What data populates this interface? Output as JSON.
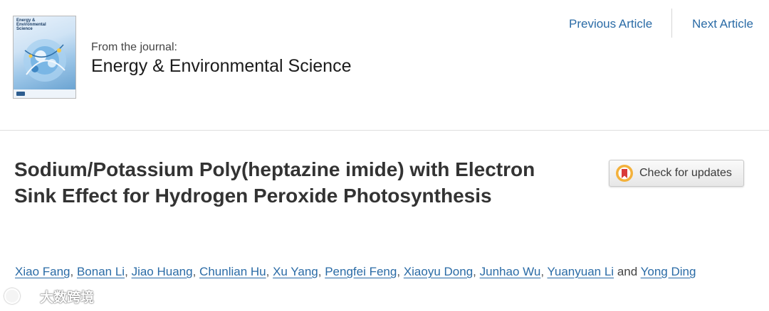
{
  "journal": {
    "cover_title": "Energy &\nEnvironmental\nScience",
    "from_label": "From the journal:",
    "name": "Energy & Environmental Science"
  },
  "nav": {
    "previous": "Previous Article",
    "next": "Next Article"
  },
  "article": {
    "title": "Sodium/Potassium Poly(heptazine imide) with Electron Sink Effect for Hydrogen Peroxide Photosynthesis"
  },
  "check_updates": {
    "label": "Check for updates",
    "icon": "crossmark-bookmark-icon"
  },
  "authors": {
    "list": [
      "Xiao Fang",
      "Bonan Li",
      "Jiao Huang",
      "Chunlian Hu",
      "Xu Yang",
      "Pengfei Feng",
      "Xiaoyu Dong",
      "Junhao Wu",
      "Yuanyuan Li",
      "Yong Ding"
    ],
    "separator": ",",
    "conjunction": "and"
  },
  "watermark": {
    "text": "大数跨境"
  },
  "colors": {
    "link": "#2a6ba6",
    "title": "#333333",
    "divider": "#dedede"
  }
}
